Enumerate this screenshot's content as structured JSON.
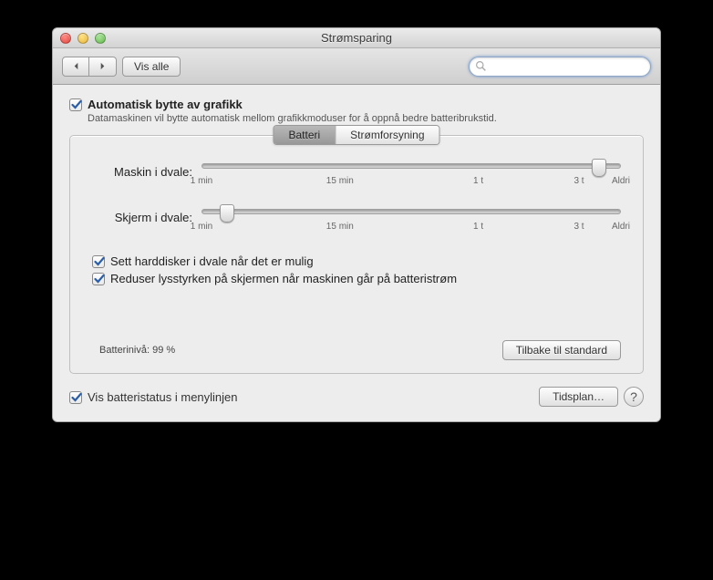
{
  "window": {
    "title": "Strømsparing"
  },
  "toolbar": {
    "show_all_label": "Vis alle",
    "search_placeholder": ""
  },
  "auto_graphics": {
    "label": "Automatisk bytte av grafikk",
    "description": "Datamaskinen vil bytte automatisk mellom grafikkmoduser for å oppnå bedre batteribrukstid.",
    "checked": true
  },
  "tabs": {
    "battery": "Batteri",
    "power": "Strømforsyning",
    "active": "battery"
  },
  "sliders": {
    "computer_sleep": {
      "label": "Maskin i dvale:",
      "position_percent": 95
    },
    "display_sleep": {
      "label": "Skjerm i dvale:",
      "position_percent": 6
    },
    "ticks": [
      "1 min",
      "15 min",
      "1 t",
      "3 t",
      "Aldri"
    ],
    "tick_positions": [
      0,
      33,
      66,
      90,
      100
    ]
  },
  "options": {
    "hdd_sleep": {
      "label": "Sett harddisker i dvale når det er mulig",
      "checked": true
    },
    "dim_display": {
      "label": "Reduser lysstyrken på skjermen når maskinen går på batteristrøm",
      "checked": true
    }
  },
  "battery_level": "Batterinivå: 99 %",
  "buttons": {
    "restore_defaults": "Tilbake til standard",
    "schedule": "Tidsplan…"
  },
  "menubar_status": {
    "label": "Vis batteristatus i menylinjen",
    "checked": true
  }
}
